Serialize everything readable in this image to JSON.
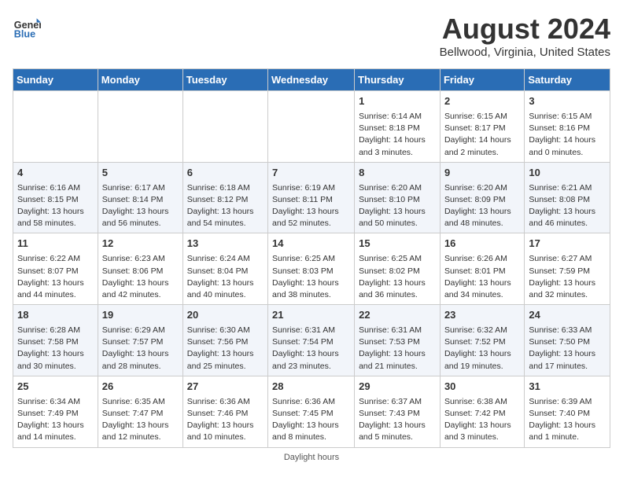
{
  "header": {
    "logo_general": "General",
    "logo_blue": "Blue",
    "title": "August 2024",
    "subtitle": "Bellwood, Virginia, United States"
  },
  "days_of_week": [
    "Sunday",
    "Monday",
    "Tuesday",
    "Wednesday",
    "Thursday",
    "Friday",
    "Saturday"
  ],
  "weeks": [
    [
      {
        "day": "",
        "info": ""
      },
      {
        "day": "",
        "info": ""
      },
      {
        "day": "",
        "info": ""
      },
      {
        "day": "",
        "info": ""
      },
      {
        "day": "1",
        "info": "Sunrise: 6:14 AM\nSunset: 8:18 PM\nDaylight: 14 hours\nand 3 minutes."
      },
      {
        "day": "2",
        "info": "Sunrise: 6:15 AM\nSunset: 8:17 PM\nDaylight: 14 hours\nand 2 minutes."
      },
      {
        "day": "3",
        "info": "Sunrise: 6:15 AM\nSunset: 8:16 PM\nDaylight: 14 hours\nand 0 minutes."
      }
    ],
    [
      {
        "day": "4",
        "info": "Sunrise: 6:16 AM\nSunset: 8:15 PM\nDaylight: 13 hours\nand 58 minutes."
      },
      {
        "day": "5",
        "info": "Sunrise: 6:17 AM\nSunset: 8:14 PM\nDaylight: 13 hours\nand 56 minutes."
      },
      {
        "day": "6",
        "info": "Sunrise: 6:18 AM\nSunset: 8:12 PM\nDaylight: 13 hours\nand 54 minutes."
      },
      {
        "day": "7",
        "info": "Sunrise: 6:19 AM\nSunset: 8:11 PM\nDaylight: 13 hours\nand 52 minutes."
      },
      {
        "day": "8",
        "info": "Sunrise: 6:20 AM\nSunset: 8:10 PM\nDaylight: 13 hours\nand 50 minutes."
      },
      {
        "day": "9",
        "info": "Sunrise: 6:20 AM\nSunset: 8:09 PM\nDaylight: 13 hours\nand 48 minutes."
      },
      {
        "day": "10",
        "info": "Sunrise: 6:21 AM\nSunset: 8:08 PM\nDaylight: 13 hours\nand 46 minutes."
      }
    ],
    [
      {
        "day": "11",
        "info": "Sunrise: 6:22 AM\nSunset: 8:07 PM\nDaylight: 13 hours\nand 44 minutes."
      },
      {
        "day": "12",
        "info": "Sunrise: 6:23 AM\nSunset: 8:06 PM\nDaylight: 13 hours\nand 42 minutes."
      },
      {
        "day": "13",
        "info": "Sunrise: 6:24 AM\nSunset: 8:04 PM\nDaylight: 13 hours\nand 40 minutes."
      },
      {
        "day": "14",
        "info": "Sunrise: 6:25 AM\nSunset: 8:03 PM\nDaylight: 13 hours\nand 38 minutes."
      },
      {
        "day": "15",
        "info": "Sunrise: 6:25 AM\nSunset: 8:02 PM\nDaylight: 13 hours\nand 36 minutes."
      },
      {
        "day": "16",
        "info": "Sunrise: 6:26 AM\nSunset: 8:01 PM\nDaylight: 13 hours\nand 34 minutes."
      },
      {
        "day": "17",
        "info": "Sunrise: 6:27 AM\nSunset: 7:59 PM\nDaylight: 13 hours\nand 32 minutes."
      }
    ],
    [
      {
        "day": "18",
        "info": "Sunrise: 6:28 AM\nSunset: 7:58 PM\nDaylight: 13 hours\nand 30 minutes."
      },
      {
        "day": "19",
        "info": "Sunrise: 6:29 AM\nSunset: 7:57 PM\nDaylight: 13 hours\nand 28 minutes."
      },
      {
        "day": "20",
        "info": "Sunrise: 6:30 AM\nSunset: 7:56 PM\nDaylight: 13 hours\nand 25 minutes."
      },
      {
        "day": "21",
        "info": "Sunrise: 6:31 AM\nSunset: 7:54 PM\nDaylight: 13 hours\nand 23 minutes."
      },
      {
        "day": "22",
        "info": "Sunrise: 6:31 AM\nSunset: 7:53 PM\nDaylight: 13 hours\nand 21 minutes."
      },
      {
        "day": "23",
        "info": "Sunrise: 6:32 AM\nSunset: 7:52 PM\nDaylight: 13 hours\nand 19 minutes."
      },
      {
        "day": "24",
        "info": "Sunrise: 6:33 AM\nSunset: 7:50 PM\nDaylight: 13 hours\nand 17 minutes."
      }
    ],
    [
      {
        "day": "25",
        "info": "Sunrise: 6:34 AM\nSunset: 7:49 PM\nDaylight: 13 hours\nand 14 minutes."
      },
      {
        "day": "26",
        "info": "Sunrise: 6:35 AM\nSunset: 7:47 PM\nDaylight: 13 hours\nand 12 minutes."
      },
      {
        "day": "27",
        "info": "Sunrise: 6:36 AM\nSunset: 7:46 PM\nDaylight: 13 hours\nand 10 minutes."
      },
      {
        "day": "28",
        "info": "Sunrise: 6:36 AM\nSunset: 7:45 PM\nDaylight: 13 hours\nand 8 minutes."
      },
      {
        "day": "29",
        "info": "Sunrise: 6:37 AM\nSunset: 7:43 PM\nDaylight: 13 hours\nand 5 minutes."
      },
      {
        "day": "30",
        "info": "Sunrise: 6:38 AM\nSunset: 7:42 PM\nDaylight: 13 hours\nand 3 minutes."
      },
      {
        "day": "31",
        "info": "Sunrise: 6:39 AM\nSunset: 7:40 PM\nDaylight: 13 hours\nand 1 minute."
      }
    ]
  ],
  "footer": "Daylight hours"
}
